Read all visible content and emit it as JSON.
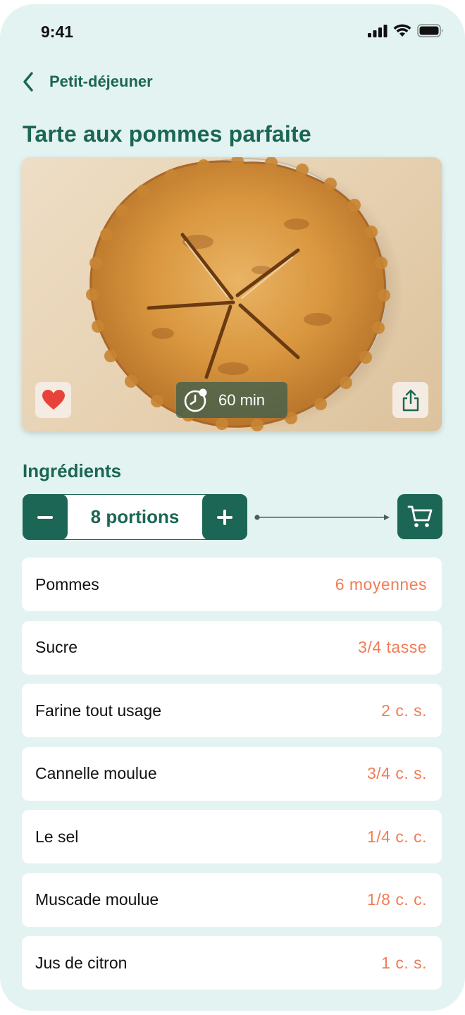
{
  "status_bar": {
    "time": "9:41"
  },
  "nav": {
    "back_label": "Petit-déjeuner"
  },
  "recipe": {
    "title": "Tarte aux pommes parfaite",
    "duration": "60 min"
  },
  "ingredients_section": {
    "title": "Ingrédients",
    "portions_label": "8 portions"
  },
  "ingredients": [
    {
      "name": "Pommes",
      "quantity": "6 moyennes"
    },
    {
      "name": "Sucre",
      "quantity": "3/4 tasse"
    },
    {
      "name": "Farine tout usage",
      "quantity": "2 c. s."
    },
    {
      "name": "Cannelle moulue",
      "quantity": "3/4 c. s."
    },
    {
      "name": "Le sel",
      "quantity": "1/4 c. c."
    },
    {
      "name": "Muscade moulue",
      "quantity": "1/8 c. c."
    },
    {
      "name": "Jus de citron",
      "quantity": "1 c. s."
    }
  ],
  "icons": {
    "back": "chevron-left-icon",
    "favorite": "heart-icon",
    "timer": "clock-icon",
    "share": "share-icon",
    "decrease": "minus-icon",
    "increase": "plus-icon",
    "cart": "cart-icon"
  },
  "colors": {
    "background": "#e3f3f1",
    "brand": "#1b6654",
    "quantity": "#f07c55",
    "favorite": "#e8433a"
  }
}
